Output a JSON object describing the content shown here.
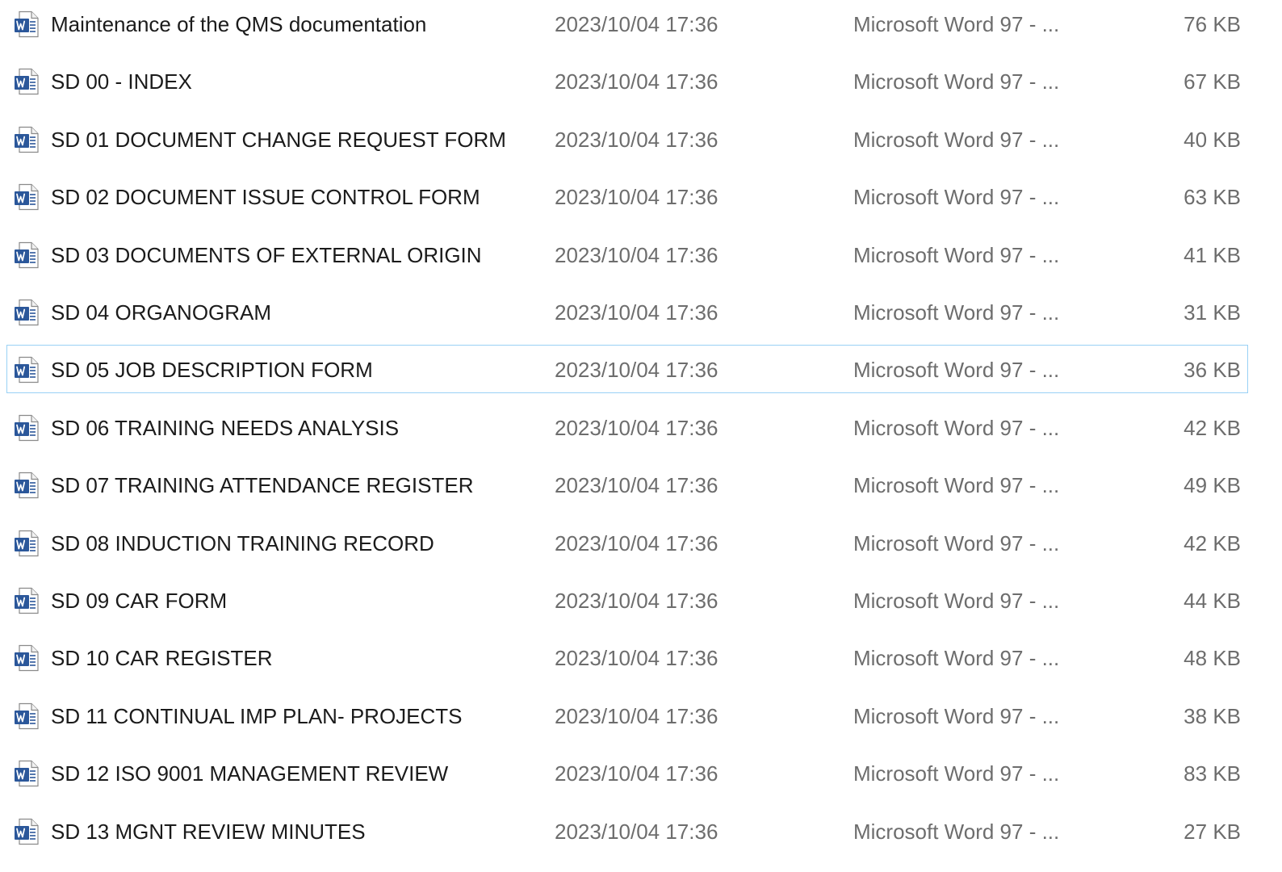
{
  "files": [
    {
      "name": "Maintenance of the QMS documentation",
      "modified": "2023/10/04 17:36",
      "type": "Microsoft Word 97 - ...",
      "size": "76 KB",
      "icon": "word-document-icon",
      "selected": false
    },
    {
      "name": "SD 00 - INDEX",
      "modified": "2023/10/04 17:36",
      "type": "Microsoft Word 97 - ...",
      "size": "67 KB",
      "icon": "word-document-icon",
      "selected": false
    },
    {
      "name": "SD 01 DOCUMENT CHANGE REQUEST FORM",
      "modified": "2023/10/04 17:36",
      "type": "Microsoft Word 97 - ...",
      "size": "40 KB",
      "icon": "word-document-icon",
      "selected": false
    },
    {
      "name": "SD 02 DOCUMENT ISSUE CONTROL FORM",
      "modified": "2023/10/04 17:36",
      "type": "Microsoft Word 97 - ...",
      "size": "63 KB",
      "icon": "word-document-icon",
      "selected": false
    },
    {
      "name": "SD 03 DOCUMENTS OF EXTERNAL ORIGIN",
      "modified": "2023/10/04 17:36",
      "type": "Microsoft Word 97 - ...",
      "size": "41 KB",
      "icon": "word-document-icon",
      "selected": false
    },
    {
      "name": "SD 04 ORGANOGRAM",
      "modified": "2023/10/04 17:36",
      "type": "Microsoft Word 97 - ...",
      "size": "31 KB",
      "icon": "word-document-icon",
      "selected": false
    },
    {
      "name": "SD 05 JOB DESCRIPTION FORM",
      "modified": "2023/10/04 17:36",
      "type": "Microsoft Word 97 - ...",
      "size": "36 KB",
      "icon": "word-document-icon",
      "selected": true
    },
    {
      "name": "SD 06 TRAINING NEEDS ANALYSIS",
      "modified": "2023/10/04 17:36",
      "type": "Microsoft Word 97 - ...",
      "size": "42 KB",
      "icon": "word-document-icon",
      "selected": false
    },
    {
      "name": "SD 07 TRAINING ATTENDANCE REGISTER",
      "modified": "2023/10/04 17:36",
      "type": "Microsoft Word 97 - ...",
      "size": "49 KB",
      "icon": "word-document-icon",
      "selected": false
    },
    {
      "name": "SD 08 INDUCTION TRAINING RECORD",
      "modified": "2023/10/04 17:36",
      "type": "Microsoft Word 97 - ...",
      "size": "42 KB",
      "icon": "word-document-icon",
      "selected": false
    },
    {
      "name": "SD 09 CAR FORM",
      "modified": "2023/10/04 17:36",
      "type": "Microsoft Word 97 - ...",
      "size": "44 KB",
      "icon": "word-document-icon",
      "selected": false
    },
    {
      "name": "SD 10 CAR REGISTER",
      "modified": "2023/10/04 17:36",
      "type": "Microsoft Word 97 - ...",
      "size": "48 KB",
      "icon": "word-document-icon",
      "selected": false
    },
    {
      "name": "SD 11 CONTINUAL IMP PLAN- PROJECTS",
      "modified": "2023/10/04 17:36",
      "type": "Microsoft Word 97 - ...",
      "size": "38 KB",
      "icon": "word-document-icon",
      "selected": false
    },
    {
      "name": "SD 12 ISO 9001 MANAGEMENT REVIEW",
      "modified": "2023/10/04 17:36",
      "type": "Microsoft Word 97 - ...",
      "size": "83 KB",
      "icon": "word-document-icon",
      "selected": false
    },
    {
      "name": "SD 13 MGNT REVIEW MINUTES",
      "modified": "2023/10/04 17:36",
      "type": "Microsoft Word 97 - ...",
      "size": "27 KB",
      "icon": "word-document-icon",
      "selected": false
    }
  ],
  "colors": {
    "name_text": "#1b1b1b",
    "secondary_text": "#6d6d6d",
    "selection_border": "#99d1f5",
    "word_blue": "#2b579a"
  }
}
